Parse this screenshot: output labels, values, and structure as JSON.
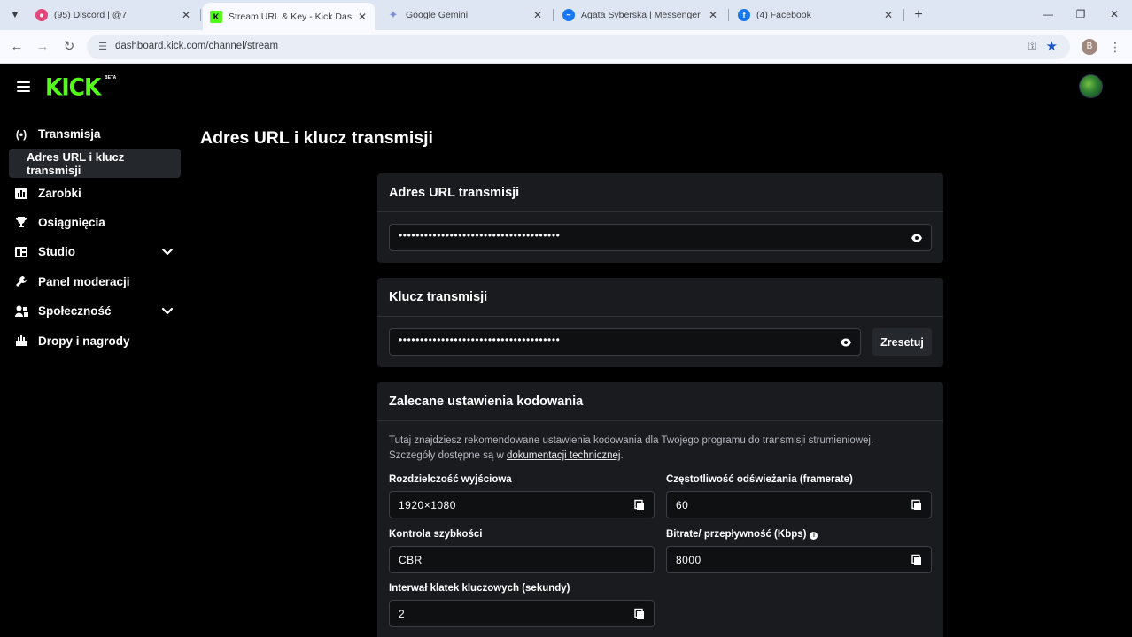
{
  "browser": {
    "tabs": [
      {
        "title": "(95) Discord | @7",
        "favicon_color": "#e5467a"
      },
      {
        "title": "Stream URL & Key - Kick Dashb",
        "favicon_color": "#53fc18",
        "active": true
      },
      {
        "title": "Google Gemini",
        "favicon_color": "#7a8fd6"
      },
      {
        "title": "Agata Syberska | Messenger",
        "favicon_color": "#1877f2"
      },
      {
        "title": "(4) Facebook",
        "favicon_color": "#1877f2"
      }
    ],
    "url": "dashboard.kick.com/channel/stream",
    "profile_initial": "B"
  },
  "app": {
    "logo": "KICK",
    "logo_badge": "BETA",
    "sidebar": {
      "items": [
        {
          "label": "Transmisja",
          "icon": "broadcast-icon"
        },
        {
          "label": "Adres URL i klucz transmisji",
          "sub": true,
          "selected": true
        },
        {
          "label": "Zarobki",
          "icon": "earnings-icon"
        },
        {
          "label": "Osiągnięcia",
          "icon": "trophy-icon"
        },
        {
          "label": "Studio",
          "icon": "studio-icon",
          "expandable": true
        },
        {
          "label": "Panel moderacji",
          "icon": "wrench-icon"
        },
        {
          "label": "Społeczność",
          "icon": "community-icon",
          "expandable": true
        },
        {
          "label": "Dropy i nagrody",
          "icon": "drops-icon"
        }
      ]
    },
    "page_title": "Adres URL i klucz transmisji",
    "url_card": {
      "title": "Adres URL transmisji",
      "masked_value": "••••••••••••••••••••••••••••••••••••••"
    },
    "key_card": {
      "title": "Klucz transmisji",
      "masked_value": "••••••••••••••••••••••••••••••••••••••",
      "reset_label": "Zresetuj"
    },
    "encoding_card": {
      "title": "Zalecane ustawienia kodowania",
      "description_line1": "Tutaj znajdziesz rekomendowane ustawienia kodowania dla Twojego programu do transmisji strumieniowej.",
      "description_line2_prefix": "Szczegóły dostępne są w ",
      "description_link": "dokumentacji technicznej",
      "description_line2_suffix": ".",
      "fields": {
        "resolution": {
          "label": "Rozdzielczość wyjściowa",
          "value": "1920×1080"
        },
        "framerate": {
          "label": "Częstotliwość odświeżania (framerate)",
          "value": "60"
        },
        "rate_control": {
          "label": "Kontrola szybkości",
          "value": "CBR"
        },
        "bitrate": {
          "label": "Bitrate/ przepływność (Kbps)",
          "value": "8000"
        },
        "keyframe": {
          "label": "Interwał klatek kluczowych (sekundy)",
          "value": "2"
        }
      }
    }
  }
}
